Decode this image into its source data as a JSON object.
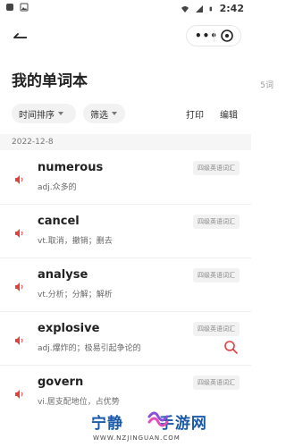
{
  "status_bar": {
    "time": "2:42",
    "icons": [
      "notification-icon",
      "image-icon",
      "wifi-icon",
      "signal-icon",
      "battery-icon"
    ]
  },
  "nav": {
    "back_icon": "back-arrow-icon",
    "more_label": "•••",
    "close_icon": "close-circle-icon"
  },
  "page": {
    "title": "我的单词本",
    "count": "5词"
  },
  "filters": {
    "sort_label": "时间排序",
    "filter_label": "筛选",
    "print_label": "打印",
    "edit_label": "编辑"
  },
  "groups": [
    {
      "date": "2022-12-8",
      "items": [
        {
          "word": "numerous",
          "meaning": "adj.众多的",
          "tag": "四级英语词汇"
        },
        {
          "word": "cancel",
          "meaning": "vt.取消，撤销；删去",
          "tag": "四级英语词汇"
        },
        {
          "word": "analyse",
          "meaning": "vt.分析；分解；解析",
          "tag": "四级英语词汇"
        },
        {
          "word": "explosive",
          "meaning": "adj.爆炸的；极易引起争论的",
          "tag": "四级英语词汇"
        },
        {
          "word": "govern",
          "meaning": "vi.居支配地位，占优势",
          "tag": "四级英语词汇"
        }
      ]
    }
  ],
  "watermark": {
    "main": "宁静",
    "main2": "手游网",
    "sub": "WWW.NZJINGUAN.COM"
  },
  "colors": {
    "accent_red": "#e04040",
    "watermark_blue": "#1a5aa8"
  }
}
